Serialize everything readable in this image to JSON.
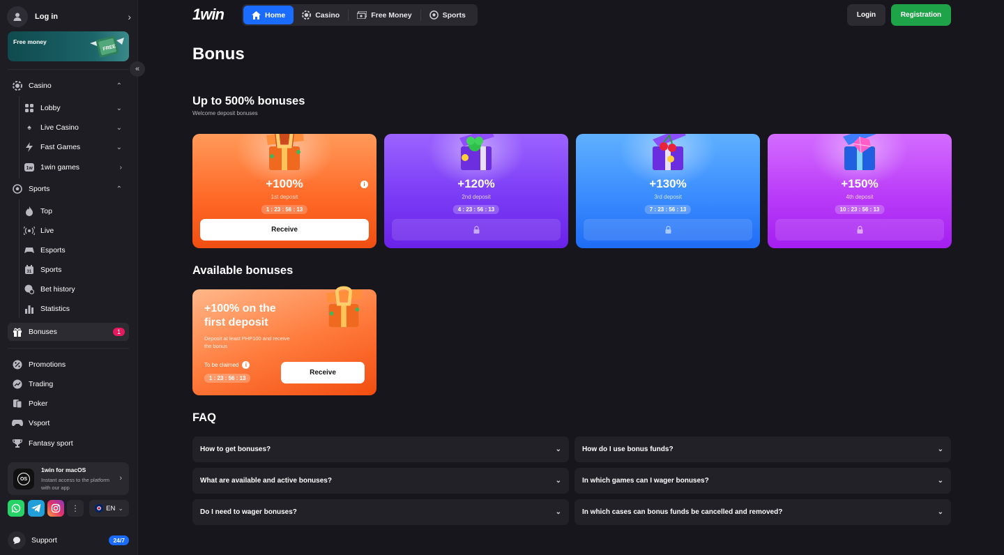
{
  "sidebar": {
    "login_label": "Log in",
    "free_money_label": "Free money",
    "casino": {
      "label": "Casino",
      "items": [
        {
          "label": "Lobby"
        },
        {
          "label": "Live Casino"
        },
        {
          "label": "Fast Games"
        },
        {
          "label": "1win games"
        }
      ]
    },
    "sports": {
      "label": "Sports",
      "items": [
        {
          "label": "Top"
        },
        {
          "label": "Live"
        },
        {
          "label": "Esports"
        },
        {
          "label": "Sports"
        },
        {
          "label": "Bet history"
        },
        {
          "label": "Statistics"
        }
      ]
    },
    "bonuses": {
      "label": "Bonuses",
      "badge": "1"
    },
    "extra": [
      {
        "label": "Promotions"
      },
      {
        "label": "Trading"
      },
      {
        "label": "Poker"
      },
      {
        "label": "Vsport"
      },
      {
        "label": "Fantasy sport"
      }
    ],
    "app_card": {
      "title": "1win for macOS",
      "desc": "Instant access to the platform with our app",
      "os_text": "OS"
    },
    "language": "EN",
    "support": {
      "label": "Support",
      "badge": "24/7"
    }
  },
  "header": {
    "logo": "1win",
    "nav": [
      {
        "label": "Home",
        "icon": "home-icon",
        "active": true
      },
      {
        "label": "Casino",
        "icon": "casino-chip-icon",
        "active": false
      },
      {
        "label": "Free Money",
        "icon": "cash-icon",
        "active": false
      },
      {
        "label": "Sports",
        "icon": "soccer-ball-icon",
        "active": false
      }
    ],
    "login_label": "Login",
    "register_label": "Registration"
  },
  "page": {
    "title": "Bonus",
    "welcome": {
      "heading": "Up to 500% bonuses",
      "subheading": "Welcome deposit bonuses",
      "cards": [
        {
          "percent": "+100%",
          "deposit": "1st deposit",
          "timer": "1 : 23 : 56 : 13",
          "button": "Receive",
          "locked": false
        },
        {
          "percent": "+120%",
          "deposit": "2nd deposit",
          "timer": "4 : 23 : 56 : 13",
          "locked": true
        },
        {
          "percent": "+130%",
          "deposit": "3rd deposit",
          "timer": "7 : 23 : 56 : 13",
          "locked": true
        },
        {
          "percent": "+150%",
          "deposit": "4th deposit",
          "timer": "10 : 23 : 56 : 13",
          "locked": true
        }
      ]
    },
    "available": {
      "heading": "Available bonuses",
      "card": {
        "title": "+100% on the first deposit",
        "desc": "Deposit at least PHP100 and receive the bonus",
        "to_be_claimed": "To be claimed",
        "timer": "1 : 23 : 56 : 13",
        "button": "Receive"
      }
    },
    "faq": {
      "heading": "FAQ",
      "items": [
        "How to get bonuses?",
        "How do I use bonus funds?",
        "What are available and active bonuses?",
        "In which games can I wager bonuses?",
        "Do I need to wager bonuses?",
        "In which cases can bonus funds be cancelled and removed?"
      ]
    }
  },
  "colors": {
    "accent_blue": "#1a6bff",
    "register_green": "#1fa348",
    "badge_red": "#e5195e",
    "card1": "#ff6a28",
    "card2": "#7a3bf5",
    "card3": "#3a8cff",
    "card4": "#b93bf8"
  }
}
